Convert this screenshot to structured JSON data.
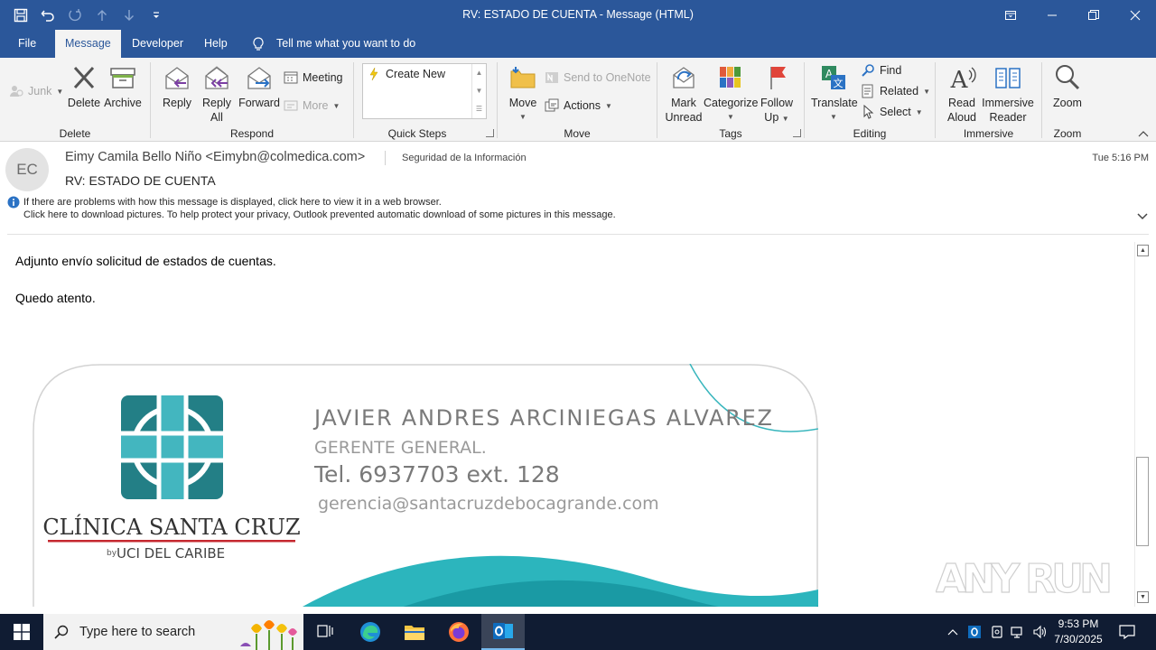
{
  "window": {
    "title": "RV: ESTADO DE CUENTA  -  Message (HTML)"
  },
  "tabs": [
    {
      "label": "File"
    },
    {
      "label": "Message"
    },
    {
      "label": "Developer"
    },
    {
      "label": "Help"
    }
  ],
  "tell_me": "Tell me what you want to do",
  "ribbon": {
    "delete_group": {
      "label": "Delete",
      "junk": "Junk",
      "delete": "Delete",
      "archive": "Archive"
    },
    "respond_group": {
      "label": "Respond",
      "reply": "Reply",
      "reply_all_1": "Reply",
      "reply_all_2": "All",
      "forward": "Forward",
      "meeting": "Meeting",
      "more": "More"
    },
    "quick_steps_group": {
      "label": "Quick Steps",
      "create_new": "Create New"
    },
    "move_group": {
      "label": "Move",
      "move": "Move",
      "send_onenote": "Send to OneNote",
      "actions": "Actions"
    },
    "tags_group": {
      "label": "Tags",
      "mark_unread_1": "Mark",
      "mark_unread_2": "Unread",
      "categorize": "Categorize",
      "follow_up_1": "Follow",
      "follow_up_2": "Up"
    },
    "editing_group": {
      "label": "Editing",
      "translate": "Translate",
      "find": "Find",
      "related": "Related",
      "select": "Select"
    },
    "immersive_group": {
      "label": "Immersive",
      "read_aloud_1": "Read",
      "read_aloud_2": "Aloud",
      "immersive_reader_1": "Immersive",
      "immersive_reader_2": "Reader"
    },
    "zoom_group": {
      "label": "Zoom",
      "zoom": "Zoom"
    }
  },
  "message": {
    "avatar_initials": "EC",
    "sender": "Eimy Camila Bello Niño <Eimybn@colmedica.com>",
    "tag": "Seguridad de la Información",
    "time": "Tue 5:16 PM",
    "subject": "RV: ESTADO DE CUENTA",
    "info_line_1": "If there are problems with how this message is displayed, click here to view it in a web browser.",
    "info_line_2": "Click here to download pictures. To help protect your privacy, Outlook prevented automatic download of some pictures in this message.",
    "body_p1": "Adjunto envío solicitud de estados de cuentas.",
    "body_p2": "Quedo atento."
  },
  "signature": {
    "clinic_name": "CLÍNICA SANTA CRUZ",
    "clinic_by": "by",
    "clinic_sub": "UCI DEL CARIBE",
    "person_name": "JAVIER ANDRES ARCINIEGAS ALVAREZ",
    "person_title": "GERENTE GENERAL.",
    "phone": "Tel. 6937703 ext. 128",
    "email": "gerencia@santacruzdebocagrande.com"
  },
  "watermark": "ANY RUN",
  "taskbar": {
    "search_placeholder": "Type here to search",
    "time": "9:53 PM",
    "date": "7/30/2025"
  },
  "colors": {
    "title_bar": "#2b579a",
    "ribbon_bg": "#f3f3f3",
    "taskbar": "#101c33",
    "teal": "#2a8a93"
  }
}
